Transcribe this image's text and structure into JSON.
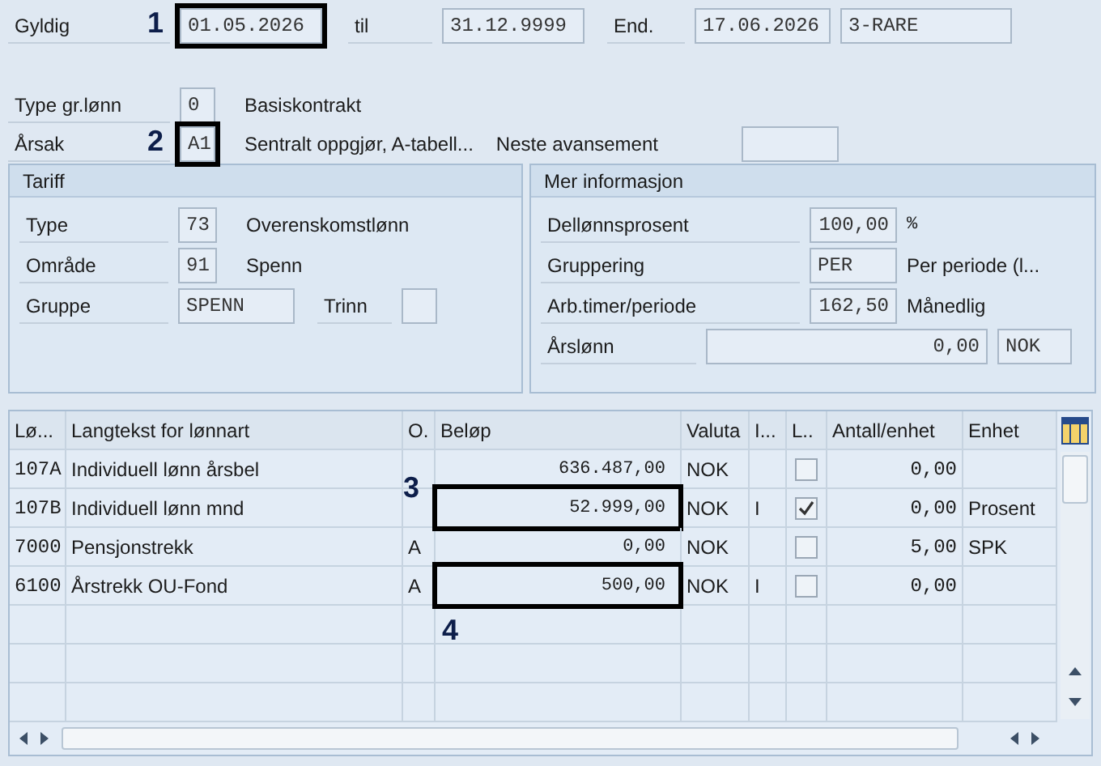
{
  "header": {
    "valid_from": {
      "label": "Gyldig",
      "value": "01.05.2026",
      "callout": "1"
    },
    "valid_to": {
      "label": "til",
      "value": "31.12.9999"
    },
    "changed": {
      "label": "End.",
      "value": "17.06.2026",
      "user": "3-RARE"
    }
  },
  "basic": {
    "type_gr_lonn": {
      "label": "Type gr.lønn",
      "value": "0",
      "text": "Basiskontrakt"
    },
    "arsak": {
      "label": "Årsak",
      "value": "A1",
      "callout": "2",
      "text": "Sentralt oppgjør, A-tabell..."
    },
    "neste_avansement": {
      "label": "Neste avansement"
    }
  },
  "tariff": {
    "title": "Tariff",
    "type": {
      "label": "Type",
      "value": "73",
      "text": "Overenskomstlønn"
    },
    "omrade": {
      "label": "Område",
      "value": "91",
      "text": "Spenn"
    },
    "gruppe": {
      "label": "Gruppe",
      "value": "SPENN"
    },
    "trinn": {
      "label": "Trinn"
    }
  },
  "mer_info": {
    "title": "Mer informasjon",
    "dellonnsprosent": {
      "label": "Dellønnsprosent",
      "value": "100,00",
      "unit": "%"
    },
    "gruppering": {
      "label": "Gruppering",
      "value": "PER",
      "text": "Per periode (l..."
    },
    "arbeidstimer": {
      "label": "Arb.timer/periode",
      "value": "162,50",
      "text": "Månedlig"
    },
    "arslonn": {
      "label": "Årslønn",
      "value": "0,00",
      "currency": "NOK"
    }
  },
  "table": {
    "columns": [
      "Lø...",
      "Langtekst for lønnart",
      "O.",
      "Beløp",
      "Valuta",
      "I...",
      "L..",
      "Antall/enhet",
      "Enhet"
    ],
    "rows": [
      {
        "code": "107A",
        "text": "Individuell lønn årsbel",
        "amount": "636.487,00",
        "currency": "NOK",
        "checked": false,
        "qty": "0,00"
      },
      {
        "code": "107B",
        "text": "Individuell lønn mnd",
        "amount": "52.999,00",
        "currency": "NOK",
        "i": "I",
        "checked": true,
        "qty": "0,00",
        "unit": "Prosent",
        "callout": "3"
      },
      {
        "code": "7000",
        "text": "Pensjonstrekk",
        "o": "A",
        "amount": "0,00",
        "currency": "NOK",
        "checked": false,
        "qty": "5,00",
        "unit": "SPK"
      },
      {
        "code": "6100",
        "text": "Årstrekk OU-Fond",
        "o": "A",
        "amount": "500,00",
        "currency": "NOK",
        "i": "I",
        "checked": false,
        "qty": "0,00",
        "callout": "4"
      }
    ]
  }
}
